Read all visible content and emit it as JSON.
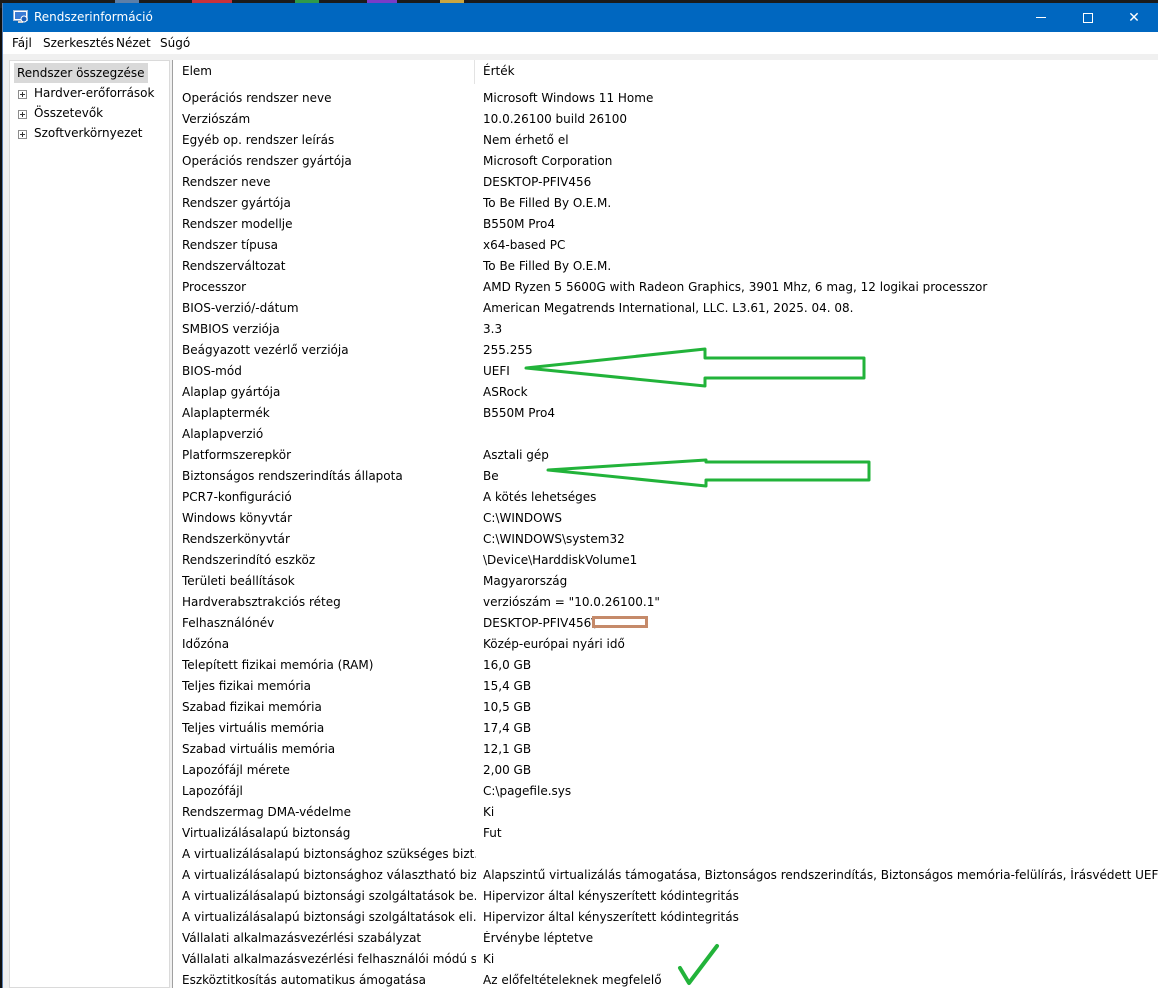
{
  "window": {
    "title": "Rendszerinformáció",
    "controls": {
      "minimize": "",
      "maximize": "",
      "close": "✕"
    }
  },
  "menu": [
    "Fájl",
    "Szerkesztés",
    "Nézet",
    "Súgó"
  ],
  "tree": {
    "root": "Rendszer összegzése",
    "children": [
      "Hardver-erőforrások",
      "Összetevők",
      "Szoftverkörnyezet"
    ]
  },
  "table": {
    "headers": {
      "item": "Elem",
      "value": "Érték"
    },
    "rows": [
      {
        "item": "Operációs rendszer neve",
        "value": "Microsoft Windows 11 Home"
      },
      {
        "item": "Verziószám",
        "value": "10.0.26100 build 26100"
      },
      {
        "item": "Egyéb op. rendszer leírás",
        "value": "Nem érhető el"
      },
      {
        "item": "Operációs rendszer gyártója",
        "value": "Microsoft Corporation"
      },
      {
        "item": "Rendszer neve",
        "value": "DESKTOP-PFIV456"
      },
      {
        "item": "Rendszer gyártója",
        "value": "To Be Filled By O.E.M."
      },
      {
        "item": "Rendszer modellje",
        "value": "B550M Pro4"
      },
      {
        "item": "Rendszer típusa",
        "value": "x64-based PC"
      },
      {
        "item": "Rendszerváltozat",
        "value": "To Be Filled By O.E.M."
      },
      {
        "item": "Processzor",
        "value": "AMD Ryzen 5 5600G with Radeon Graphics, 3901 Mhz, 6 mag, 12 logikai processzor"
      },
      {
        "item": "BIOS-verzió/-dátum",
        "value": "American Megatrends International, LLC. L3.61, 2025. 04. 08."
      },
      {
        "item": "SMBIOS verziója",
        "value": "3.3"
      },
      {
        "item": "Beágyazott vezérlő verziója",
        "value": "255.255"
      },
      {
        "item": "BIOS-mód",
        "value": "UEFI"
      },
      {
        "item": "Alaplap gyártója",
        "value": "ASRock"
      },
      {
        "item": "Alaplaptermék",
        "value": "B550M Pro4"
      },
      {
        "item": "Alaplapverzió",
        "value": ""
      },
      {
        "item": "Platformszerepkör",
        "value": "Asztali gép"
      },
      {
        "item": "Biztonságos rendszerindítás állapota",
        "value": "Be"
      },
      {
        "item": "PCR7-konfiguráció",
        "value": "A kötés lehetséges"
      },
      {
        "item": "Windows könyvtár",
        "value": "C:\\WINDOWS"
      },
      {
        "item": "Rendszerkönyvtár",
        "value": "C:\\WINDOWS\\system32"
      },
      {
        "item": "Rendszerindító eszköz",
        "value": "\\Device\\HarddiskVolume1"
      },
      {
        "item": "Területi beállítások",
        "value": "Magyarország"
      },
      {
        "item": "Hardverabsztrakciós réteg",
        "value": "verziószám = \"10.0.26100.1\""
      },
      {
        "item": "Felhasználónév",
        "value": "DESKTOP-PFIV456\\"
      },
      {
        "item": "Időzóna",
        "value": "Közép-európai nyári idő"
      },
      {
        "item": "Telepített fizikai memória (RAM)",
        "value": "16,0 GB"
      },
      {
        "item": "Teljes fizikai memória",
        "value": "15,4 GB"
      },
      {
        "item": "Szabad fizikai memória",
        "value": "10,5 GB"
      },
      {
        "item": "Teljes virtuális memória",
        "value": "17,4 GB"
      },
      {
        "item": "Szabad virtuális memória",
        "value": "12,1 GB"
      },
      {
        "item": "Lapozófájl mérete",
        "value": "2,00 GB"
      },
      {
        "item": "Lapozófájl",
        "value": "C:\\pagefile.sys"
      },
      {
        "item": "Rendszermag DMA-védelme",
        "value": "Ki"
      },
      {
        "item": "Virtualizálásalapú biztonság",
        "value": "Fut"
      },
      {
        "item": "A virtualizálásalapú biztonsághoz szükséges bizt...",
        "value": ""
      },
      {
        "item": "A virtualizálásalapú biztonsághoz választható biz...",
        "value": "Alapszintű virtualizálás támogatása, Biztonságos rendszerindítás, Biztonságos memória-felülírás, Írásvédett UEFI-kód"
      },
      {
        "item": "A virtualizálásalapú biztonsági szolgáltatások be...",
        "value": "Hipervizor által kényszerített kódintegritás"
      },
      {
        "item": "A virtualizálásalapú biztonsági szolgáltatások eli...",
        "value": "Hipervizor által kényszerített kódintegritás"
      },
      {
        "item": "Vállalati alkalmazásvezérlési szabályzat",
        "value": "Érvénybe léptetve"
      },
      {
        "item": "Vállalati alkalmazásvezérlési felhasználói módú s...",
        "value": "Ki"
      },
      {
        "item": "Eszköztitkosítás automatikus ámogatása",
        "value": "Az előfeltételeknek megfelelő"
      }
    ]
  },
  "annotations": {
    "arrow_color": "#22b33a",
    "check_color": "#22b33a",
    "redaction_color": "#c58a6a"
  }
}
